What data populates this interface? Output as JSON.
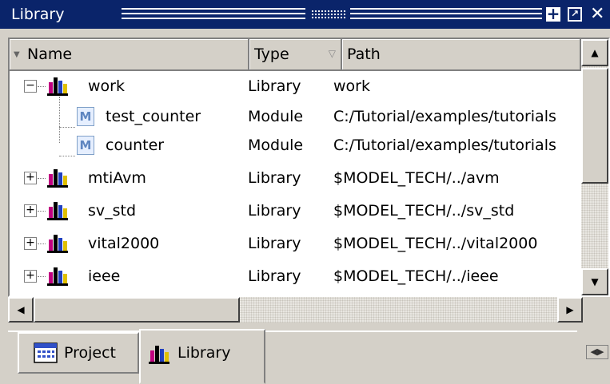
{
  "window": {
    "title": "Library"
  },
  "columns": {
    "name": "Name",
    "type": "Type",
    "path": "Path"
  },
  "rows": [
    {
      "name": "work",
      "type": "Library",
      "path": "work",
      "kind": "library",
      "expander": "−"
    },
    {
      "name": "test_counter",
      "type": "Module",
      "path": "C:/Tutorial/examples/tutorials",
      "kind": "module"
    },
    {
      "name": "counter",
      "type": "Module",
      "path": "C:/Tutorial/examples/tutorials",
      "kind": "module"
    },
    {
      "name": "mtiAvm",
      "type": "Library",
      "path": "$MODEL_TECH/../avm",
      "kind": "library",
      "expander": "+"
    },
    {
      "name": "sv_std",
      "type": "Library",
      "path": "$MODEL_TECH/../sv_std",
      "kind": "library",
      "expander": "+"
    },
    {
      "name": "vital2000",
      "type": "Library",
      "path": "$MODEL_TECH/../vital2000",
      "kind": "library",
      "expander": "+"
    },
    {
      "name": "ieee",
      "type": "Library",
      "path": "$MODEL_TECH/../ieee",
      "kind": "library",
      "expander": "+"
    }
  ],
  "module_icon_letter": "M",
  "tabs": [
    {
      "label": "Project",
      "icon": "project-icon",
      "active": false
    },
    {
      "label": "Library",
      "icon": "library-icon",
      "active": true
    }
  ],
  "colors": {
    "titlebar": "#0a246a",
    "chrome": "#d4d0c8"
  }
}
